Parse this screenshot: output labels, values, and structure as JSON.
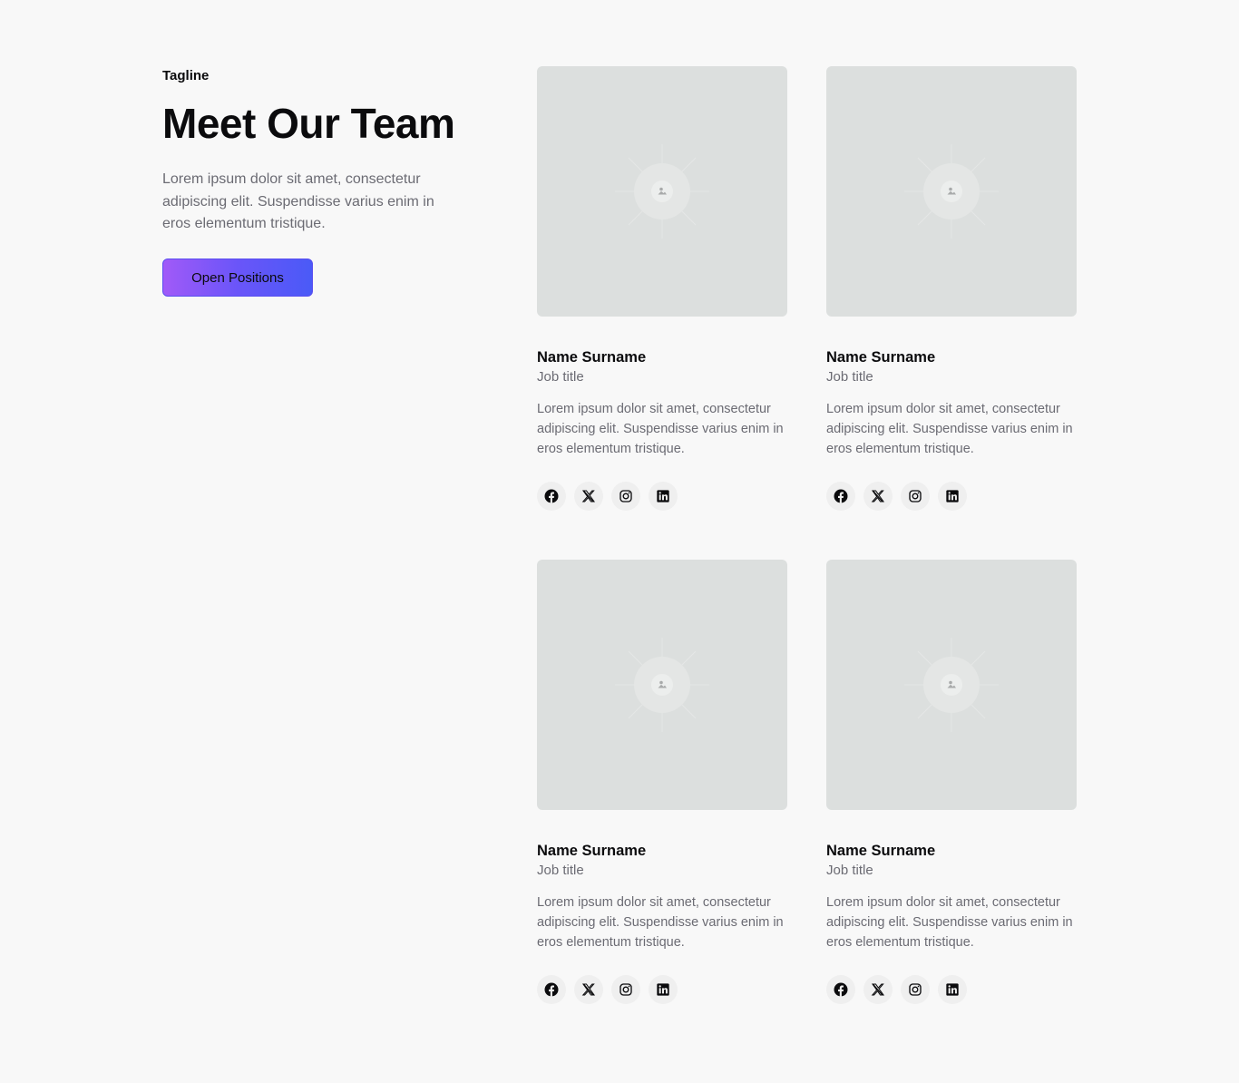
{
  "intro": {
    "tagline": "Tagline",
    "heading": "Meet Our Team",
    "description": "Lorem ipsum dolor sit amet, consectetur adipiscing elit. Suspendisse varius enim in eros elementum tristique.",
    "cta_label": "Open Positions"
  },
  "team": [
    {
      "name": "Name Surname",
      "role": "Job title",
      "bio": "Lorem ipsum dolor sit amet, consectetur adipiscing elit. Suspendisse varius enim in eros elementum tristique.",
      "socials": [
        "facebook-icon",
        "x-icon",
        "instagram-icon",
        "linkedin-icon"
      ]
    },
    {
      "name": "Name Surname",
      "role": "Job title",
      "bio": "Lorem ipsum dolor sit amet, consectetur adipiscing elit. Suspendisse varius enim in eros elementum tristique.",
      "socials": [
        "facebook-icon",
        "x-icon",
        "instagram-icon",
        "linkedin-icon"
      ]
    },
    {
      "name": "Name Surname",
      "role": "Job title",
      "bio": "Lorem ipsum dolor sit amet, consectetur adipiscing elit. Suspendisse varius enim in eros elementum tristique.",
      "socials": [
        "facebook-icon",
        "x-icon",
        "instagram-icon",
        "linkedin-icon"
      ]
    },
    {
      "name": "Name Surname",
      "role": "Job title",
      "bio": "Lorem ipsum dolor sit amet, consectetur adipiscing elit. Suspendisse varius enim in eros elementum tristique.",
      "socials": [
        "facebook-icon",
        "x-icon",
        "instagram-icon",
        "linkedin-icon"
      ]
    }
  ],
  "colors": {
    "background": "#f8f8f8",
    "placeholder": "#dcdfde",
    "text": "#0b0b0d",
    "muted": "#6b6b73",
    "accent_start": "#a15af8",
    "accent_end": "#4a5af7"
  }
}
